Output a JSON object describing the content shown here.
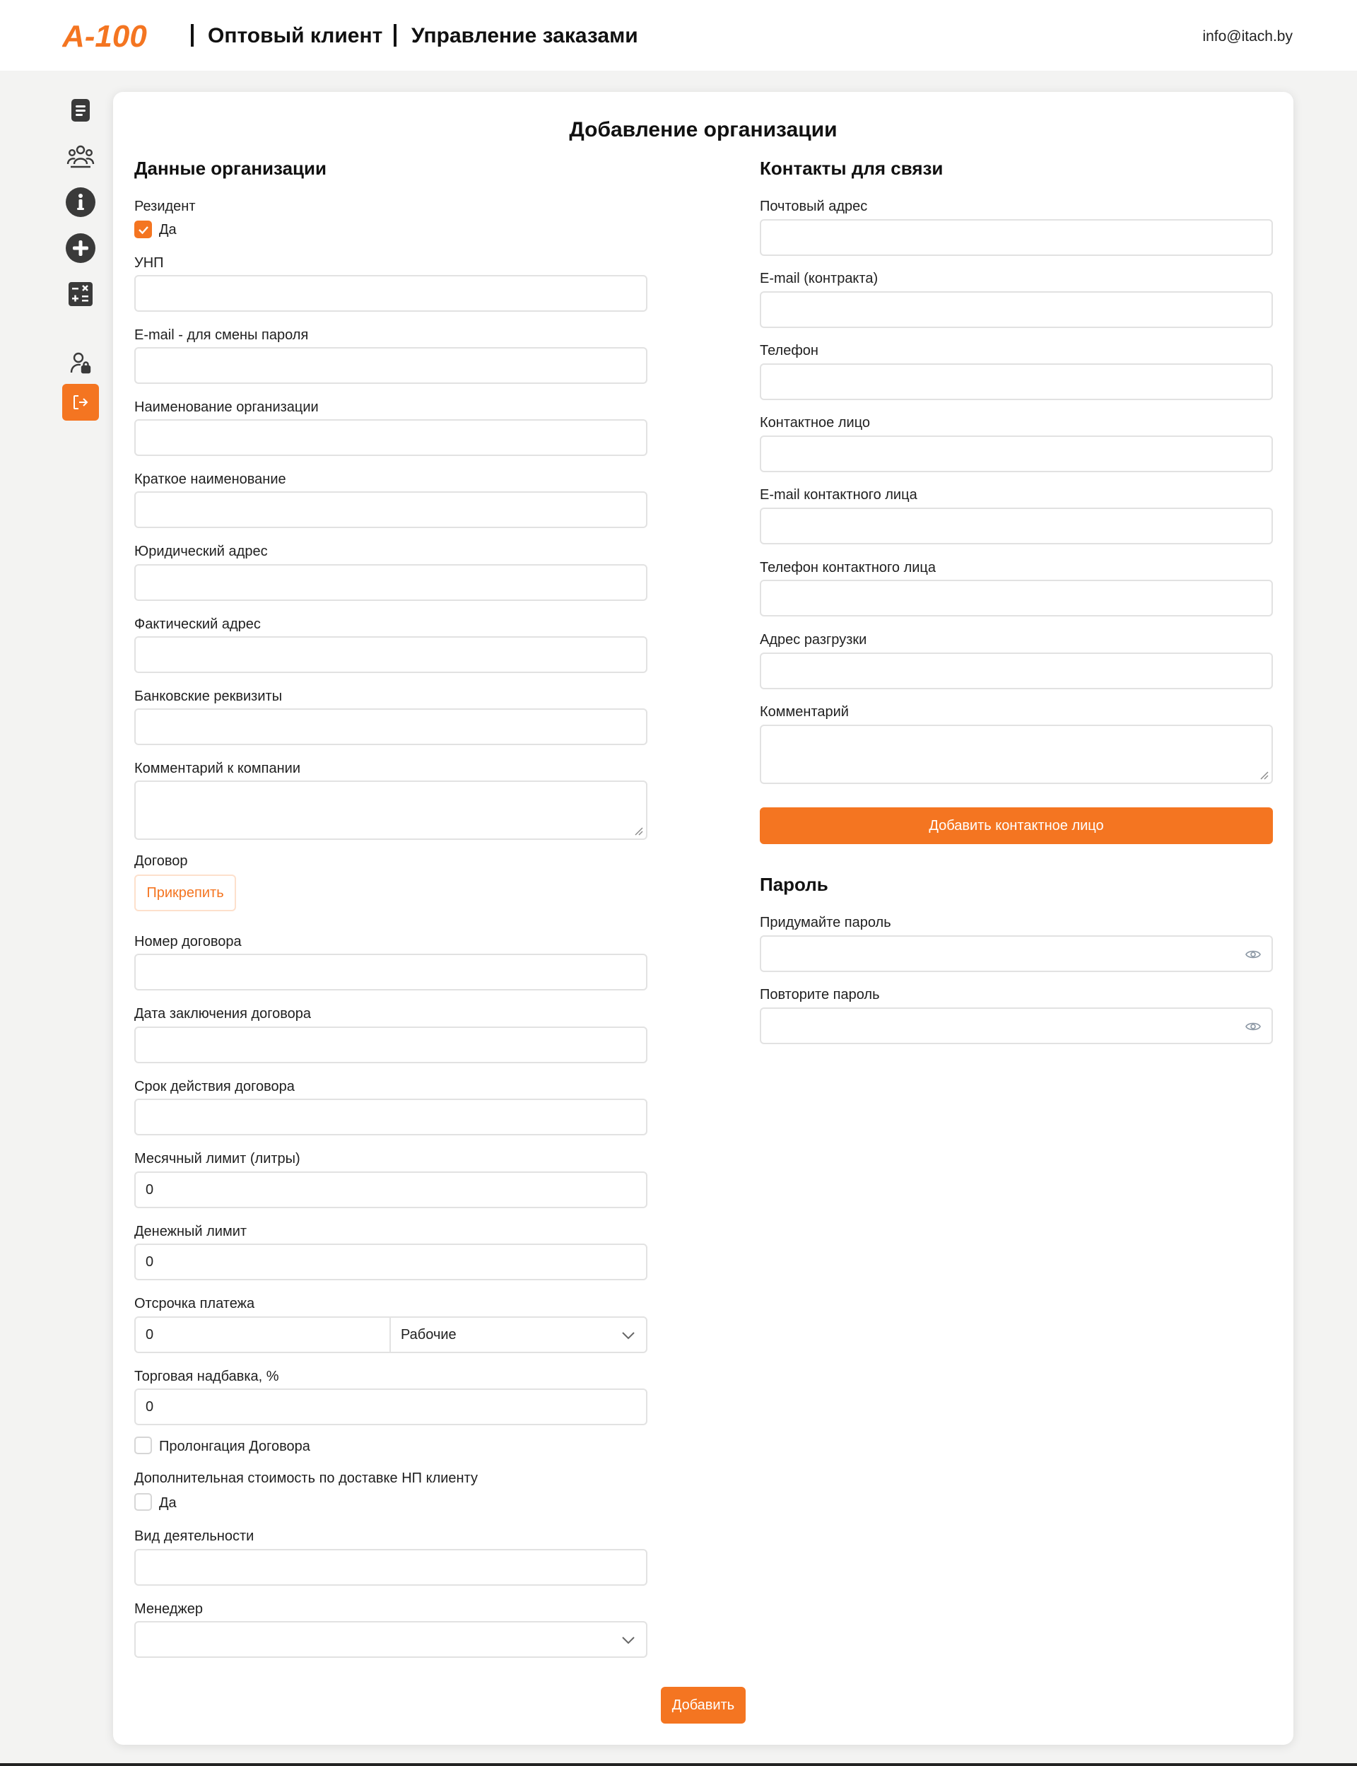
{
  "header": {
    "logo_text": "A-100",
    "section": "Оптовый клиент",
    "subsection": "Управление заказами",
    "email": "info@itach.by"
  },
  "sidebar": {
    "items": [
      {
        "name": "documents",
        "icon": "document-list-icon"
      },
      {
        "name": "users",
        "icon": "users-group-icon"
      },
      {
        "name": "info",
        "icon": "info-circle-icon"
      },
      {
        "name": "add",
        "icon": "plus-circle-icon"
      },
      {
        "name": "calculator",
        "icon": "calculator-icon"
      },
      {
        "name": "user-lock",
        "icon": "user-lock-icon"
      },
      {
        "name": "logout",
        "icon": "logout-icon",
        "active": true
      }
    ]
  },
  "page": {
    "title": "Добавление организации"
  },
  "org": {
    "section_title": "Данные организации",
    "resident_label": "Резидент",
    "resident_checkbox_label": "Да",
    "resident_checked": true,
    "unp_label": "УНП",
    "email_label": "E-mail - для смены пароля",
    "name_label": "Наименование организации",
    "short_name_label": "Краткое наименование",
    "legal_address_label": "Юридический адрес",
    "actual_address_label": "Фактический адрес",
    "bank_label": "Банковские реквизиты",
    "comment_label": "Комментарий к компании",
    "contract_label": "Договор",
    "attach_button": "Прикрепить",
    "contract_number_label": "Номер договора",
    "contract_date_label": "Дата заключения договора",
    "contract_term_label": "Срок действия договора",
    "monthly_limit_label": "Месячный лимит (литры)",
    "monthly_limit_value": "0",
    "money_limit_label": "Денежный лимит",
    "money_limit_value": "0",
    "deferral_label": "Отсрочка платежа",
    "deferral_value": "0",
    "deferral_type_value": "Рабочие",
    "markup_label": "Торговая надбавка, %",
    "markup_value": "0",
    "prolongation_label": "Пролонгация Договора",
    "prolongation_checked": false,
    "extra_delivery_label": "Дополнительная стоимость по доставке НП клиенту",
    "extra_delivery_checkbox_label": "Да",
    "extra_delivery_checked": false,
    "activity_label": "Вид деятельности",
    "manager_label": "Менеджер"
  },
  "contacts": {
    "section_title": "Контакты для связи",
    "postal_label": "Почтовый адрес",
    "contract_email_label": "E-mail (контракта)",
    "phone_label": "Телефон",
    "contact_person_label": "Контактное лицо",
    "contact_email_label": "E-mail контактного лица",
    "contact_phone_label": "Телефон контактного лица",
    "unload_address_label": "Адрес разгрузки",
    "comment_label": "Комментарий",
    "add_contact_button": "Добавить контактное лицо"
  },
  "password": {
    "section_title": "Пароль",
    "new_label": "Придумайте пароль",
    "repeat_label": "Повторите пароль"
  },
  "submit_button": "Добавить",
  "colors": {
    "accent": "#f47521",
    "icon_dark": "#3a3a3a",
    "border": "#e2e2e2",
    "background": "#f3f3f2"
  }
}
